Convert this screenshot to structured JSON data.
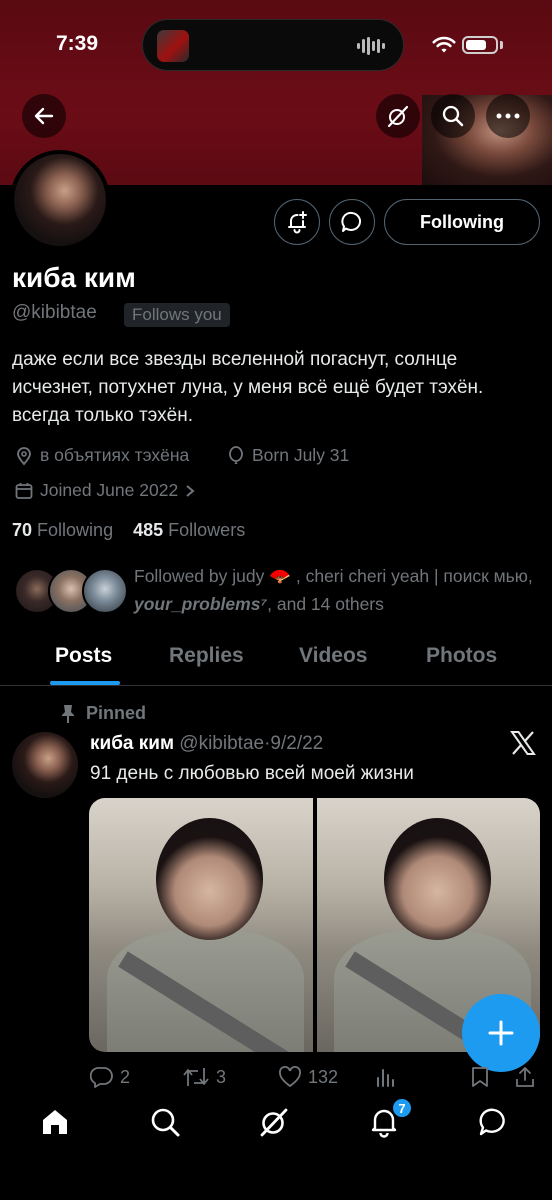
{
  "status_bar": {
    "time": "7:39"
  },
  "header": {
    "back_icon": "arrow-left-icon",
    "grok_icon": "grok-icon",
    "search_icon": "search-icon",
    "more_icon": "more-horizontal-icon"
  },
  "profile": {
    "name": "киба ким",
    "handle": "@kibibtae",
    "follows_you": "Follows you",
    "following_button": "Following",
    "bio": "даже если все звезды вселенной погаснут, солнце исчезнет, потухнет луна, у меня всё ещё будет тэхён. всегда только тэхён.",
    "location": "в объятиях тэхёна",
    "birthday": "Born July 31",
    "joined": "Joined June 2022",
    "following_count": "70",
    "following_label": "Following",
    "followers_count": "485",
    "followers_label": "Followers",
    "followed_by_prefix": "Followed by judy 🪭 , cheri cheri yeah | поиск мью, ",
    "followed_by_italic": "your_problems⁷",
    "followed_by_suffix": ", and 14 others"
  },
  "tabs": [
    "Posts",
    "Replies",
    "Videos",
    "Photos"
  ],
  "post": {
    "pinned_label": "Pinned",
    "author_name": "киба ким",
    "author_handle": "@kibibtae",
    "date": "9/2/22",
    "text": "91 день с любовью всей моей жизни",
    "replies": "2",
    "reposts": "3",
    "likes": "132"
  },
  "bottom_nav": {
    "items": [
      "home-icon",
      "search-icon",
      "grok-icon",
      "notifications-icon",
      "messages-icon"
    ],
    "notifications_badge": "7"
  },
  "colors": {
    "accent": "#1d9bf0",
    "banner": "#6b0c16",
    "muted": "#71767b"
  }
}
